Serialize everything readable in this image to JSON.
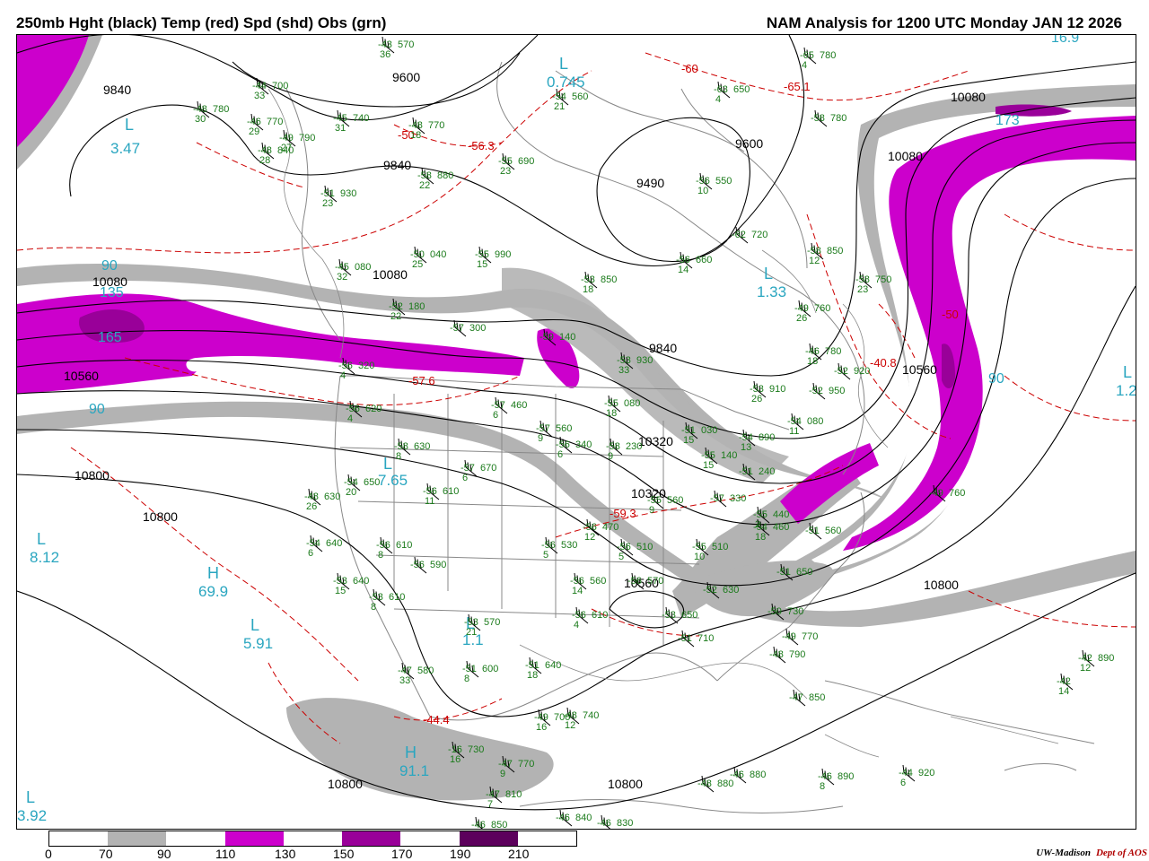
{
  "header": {
    "left_title": "250mb Hght (black) Temp (red) Spd (shd) Obs (grn)",
    "right_title": "NAM Analysis for 1200 UTC Monday  JAN 12 2026"
  },
  "legend": {
    "colors": [
      "#ffffff",
      "#b3b3b3",
      "#ffffff",
      "#cc00cc",
      "#ffffff",
      "#990099",
      "#ffffff",
      "#5c005c",
      "#ffffff"
    ],
    "labels": [
      "0",
      "70",
      "90",
      "110",
      "130",
      "150",
      "170",
      "190",
      "210"
    ]
  },
  "credit": {
    "org": "UW-Madison",
    "dept": "Dept of AOS"
  },
  "colors": {
    "jet_gray": "#b3b3b3",
    "jet_magenta": "#cc00cc",
    "jet_purple": "#990099",
    "jet_dark": "#5c005c",
    "height_contour": "#000000",
    "temp_contour": "#cc0000",
    "obs": "#1a7a1a",
    "hl_marker": "#2aa6c0",
    "borders": "#888888"
  },
  "height_labels": [
    "9840",
    "9600",
    "9840",
    "9490",
    "9600",
    "9840",
    "10080",
    "10080",
    "10080",
    "10560",
    "10080",
    "10320",
    "10560",
    "10320",
    "10800",
    "10800",
    "10800",
    "10800",
    "10800",
    "10560"
  ],
  "hl_markers": [
    {
      "letter": "L",
      "value": "3.47"
    },
    {
      "letter": "L",
      "value": "0.745"
    },
    {
      "letter": "L",
      "value": "1.33"
    },
    {
      "letter": "H",
      "value": "69.9"
    },
    {
      "letter": "L",
      "value": "8.12"
    },
    {
      "letter": "L",
      "value": "5.91"
    },
    {
      "letter": "H",
      "value": "91.1"
    },
    {
      "letter": "L",
      "value": "3.92"
    },
    {
      "letter": "L",
      "value": "1.1"
    },
    {
      "letter": "L",
      "value": "7.65"
    },
    {
      "letter": "L",
      "value": "1.2"
    }
  ],
  "speed_labels": [
    "90",
    "135",
    "90",
    "173",
    "90",
    "165",
    "16.9"
  ],
  "temp_labels": [
    "-50",
    "-56.3",
    "-60",
    "-65.1",
    "-57.6",
    "-59.3",
    "-44.4",
    "-40.8",
    "-50"
  ],
  "observations": [
    {
      "t": "-43",
      "h": "570",
      "d": "36"
    },
    {
      "t": "-44",
      "h": "700",
      "d": "33"
    },
    {
      "t": "-48",
      "h": "780",
      "d": "30"
    },
    {
      "t": "-46",
      "h": "770",
      "d": "29"
    },
    {
      "t": "-45",
      "h": "740",
      "d": "31"
    },
    {
      "t": "-48",
      "h": "770",
      "d": "18"
    },
    {
      "t": "-49",
      "h": "790",
      "d": "27"
    },
    {
      "t": "-48",
      "h": "840",
      "d": "28"
    },
    {
      "t": "-55",
      "h": "690",
      "d": "23"
    },
    {
      "t": "-54",
      "h": "560",
      "d": "21"
    },
    {
      "t": "-63",
      "h": "650",
      "d": "4"
    },
    {
      "t": "-65",
      "h": "780",
      "d": "4"
    },
    {
      "t": "-58",
      "h": "780",
      "d": ""
    },
    {
      "t": "-51",
      "h": "930",
      "d": "23"
    },
    {
      "t": "-58",
      "h": "880",
      "d": "22"
    },
    {
      "t": "-56",
      "h": "550",
      "d": "10"
    },
    {
      "t": "-62",
      "h": "720",
      "d": ""
    },
    {
      "t": "-58",
      "h": "850",
      "d": "12"
    },
    {
      "t": "-50",
      "h": "040",
      "d": "25"
    },
    {
      "t": "-55",
      "h": "990",
      "d": "15"
    },
    {
      "t": "-45",
      "h": "080",
      "d": "32"
    },
    {
      "t": "-56",
      "h": "660",
      "d": "14"
    },
    {
      "t": "-53",
      "h": "850",
      "d": "18"
    },
    {
      "t": "-58",
      "h": "750",
      "d": "23"
    },
    {
      "t": "-49",
      "h": "760",
      "d": "26"
    },
    {
      "t": "-52",
      "h": "180",
      "d": "22"
    },
    {
      "t": "-57",
      "h": "300",
      "d": ""
    },
    {
      "t": "-59",
      "h": "140",
      "d": ""
    },
    {
      "t": "-53",
      "h": "930",
      "d": "33"
    },
    {
      "t": "-46",
      "h": "780",
      "d": "18"
    },
    {
      "t": "-52",
      "h": "920",
      "d": ""
    },
    {
      "t": "-56",
      "h": "320",
      "d": "4"
    },
    {
      "t": "-53",
      "h": "910",
      "d": "26"
    },
    {
      "t": "-52",
      "h": "950",
      "d": ""
    },
    {
      "t": "-56",
      "h": "620",
      "d": "4"
    },
    {
      "t": "-57",
      "h": "460",
      "d": "6"
    },
    {
      "t": "-57",
      "h": "560",
      "d": "9"
    },
    {
      "t": "-55",
      "h": "080",
      "d": "18"
    },
    {
      "t": "-54",
      "h": "080",
      "d": "11"
    },
    {
      "t": "-58",
      "h": "630",
      "d": "8"
    },
    {
      "t": "-56",
      "h": "340",
      "d": "6"
    },
    {
      "t": "-58",
      "h": "230",
      "d": "9"
    },
    {
      "t": "-51",
      "h": "030",
      "d": "15"
    },
    {
      "t": "-54",
      "h": "890",
      "d": "13"
    },
    {
      "t": "-57",
      "h": "670",
      "d": "6"
    },
    {
      "t": "-55",
      "h": "140",
      "d": "15"
    },
    {
      "t": "-51",
      "h": "240",
      "d": ""
    },
    {
      "t": "-54",
      "h": "650",
      "d": "20"
    },
    {
      "t": "-48",
      "h": "630",
      "d": "26"
    },
    {
      "t": "-56",
      "h": "610",
      "d": "11"
    },
    {
      "t": "-55",
      "h": "560",
      "d": "9"
    },
    {
      "t": "-57",
      "h": "330",
      "d": ""
    },
    {
      "t": "-55",
      "h": "440",
      "d": "2"
    },
    {
      "t": "-54",
      "h": "460",
      "d": "18"
    },
    {
      "t": "-51",
      "h": "560",
      "d": ""
    },
    {
      "t": "-49",
      "h": "760",
      "d": ""
    },
    {
      "t": "-54",
      "h": "640",
      "d": "6"
    },
    {
      "t": "-56",
      "h": "610",
      "d": "8"
    },
    {
      "t": "-56",
      "h": "590",
      "d": ""
    },
    {
      "t": "-56",
      "h": "470",
      "d": "12"
    },
    {
      "t": "-56",
      "h": "530",
      "d": "5"
    },
    {
      "t": "-56",
      "h": "510",
      "d": "5"
    },
    {
      "t": "-55",
      "h": "510",
      "d": "10"
    },
    {
      "t": "-53",
      "h": "640",
      "d": "15"
    },
    {
      "t": "-53",
      "h": "610",
      "d": "8"
    },
    {
      "t": "-56",
      "h": "560",
      "d": "14"
    },
    {
      "t": "-56",
      "h": "570",
      "d": ""
    },
    {
      "t": "-52",
      "h": "630",
      "d": ""
    },
    {
      "t": "-51",
      "h": "650",
      "d": ""
    },
    {
      "t": "-53",
      "h": "570",
      "d": "21"
    },
    {
      "t": "-56",
      "h": "610",
      "d": "4"
    },
    {
      "t": "-53",
      "h": "650",
      "d": ""
    },
    {
      "t": "-50",
      "h": "730",
      "d": ""
    },
    {
      "t": "-51",
      "h": "710",
      "d": ""
    },
    {
      "t": "-49",
      "h": "770",
      "d": ""
    },
    {
      "t": "-47",
      "h": "580",
      "d": "33"
    },
    {
      "t": "-51",
      "h": "600",
      "d": "8"
    },
    {
      "t": "-51",
      "h": "640",
      "d": "18"
    },
    {
      "t": "-48",
      "h": "790",
      "d": ""
    },
    {
      "t": "-47",
      "h": "850",
      "d": ""
    },
    {
      "t": "-49",
      "h": "700",
      "d": "16"
    },
    {
      "t": "-48",
      "h": "740",
      "d": "12"
    },
    {
      "t": "-42",
      "h": "890",
      "d": "12"
    },
    {
      "t": "-42",
      "h": "",
      "d": "14"
    },
    {
      "t": "-16",
      "h": "730",
      "d": "16"
    },
    {
      "t": "-47",
      "h": "770",
      "d": "9"
    },
    {
      "t": "-47",
      "h": "810",
      "d": "7"
    },
    {
      "t": "-46",
      "h": "850",
      "d": ""
    },
    {
      "t": "-46",
      "h": "840",
      "d": ""
    },
    {
      "t": "-46",
      "h": "830",
      "d": ""
    },
    {
      "t": "-48",
      "h": "880",
      "d": ""
    },
    {
      "t": "-46",
      "h": "880",
      "d": ""
    },
    {
      "t": "-46",
      "h": "890",
      "d": "8"
    },
    {
      "t": "-44",
      "h": "920",
      "d": "6"
    }
  ]
}
